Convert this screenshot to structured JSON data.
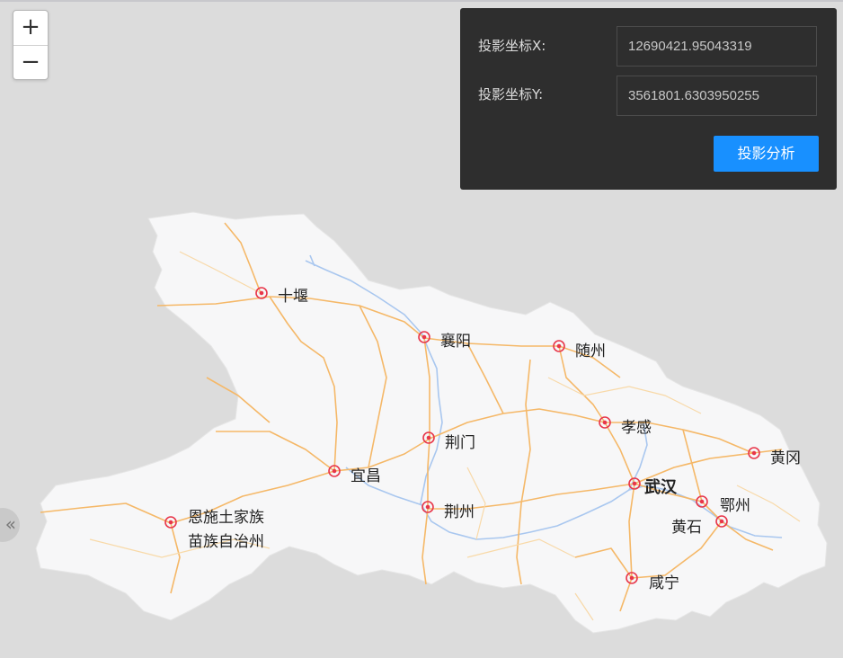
{
  "zoom": {
    "in_label": "+",
    "out_label": "−"
  },
  "panel": {
    "x_label": "投影坐标X:",
    "x_value": "12690421.95043319",
    "y_label": "投影坐标Y:",
    "y_value": "3561801.6303950255",
    "button_label": "投影分析"
  },
  "collapse_label": "«",
  "cities": {
    "shiyan": "十堰",
    "xiangyang": "襄阳",
    "suizhou": "随州",
    "xiaogan": "孝感",
    "jingmen": "荆门",
    "huanggang": "黄冈",
    "yichang": "宜昌",
    "wuhan": "武汉",
    "ezhou": "鄂州",
    "huangshi": "黄石",
    "jingzhou": "荆州",
    "enshi_line1": "恩施土家族",
    "enshi_line2": "苗族自治州",
    "xianning": "咸宁"
  },
  "colors": {
    "land": "#f7f7f8",
    "road_major": "#f5b868",
    "road_minor": "#f8d9a8",
    "water": "#a9c7ef",
    "marker": "#e8364a",
    "button": "#1890ff"
  }
}
